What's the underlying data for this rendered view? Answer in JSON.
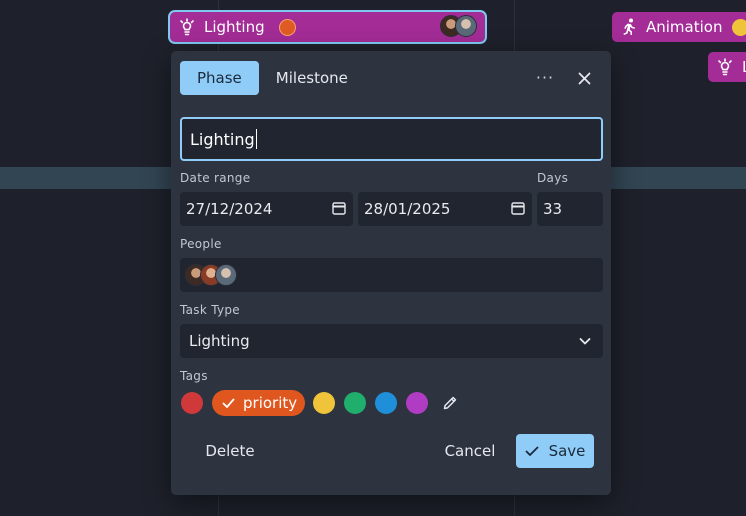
{
  "timeline": {
    "bars": [
      {
        "label": "Lighting",
        "icon": "lightbulb-icon",
        "color": "#a32c96",
        "tag_color": "#e05a24"
      },
      {
        "label": "Animation",
        "icon": "running-person-icon",
        "color": "#a32c96",
        "tag_color": "#f0c43a"
      },
      {
        "label": "L",
        "icon": "lightbulb-icon",
        "color": "#a32c96"
      }
    ]
  },
  "dialog": {
    "tabs": [
      {
        "label": "Phase",
        "active": true
      },
      {
        "label": "Milestone",
        "active": false
      }
    ],
    "more_label": "···",
    "name_value": "Lighting",
    "date_range_label": "Date range",
    "start_date": "27/12/2024",
    "end_date": "28/01/2025",
    "days_label": "Days",
    "days_value": "33",
    "people_label": "People",
    "people": [
      "avatar-1",
      "avatar-2",
      "avatar-3"
    ],
    "task_type_label": "Task Type",
    "task_type_value": "Lighting",
    "tags_label": "Tags",
    "tags": [
      {
        "color": "#d0393a",
        "label": ""
      },
      {
        "color": "#e0561f",
        "label": "priority",
        "selected": true
      },
      {
        "color": "#f0c43a",
        "label": ""
      },
      {
        "color": "#1fae6c",
        "label": ""
      },
      {
        "color": "#1e8fd8",
        "label": ""
      },
      {
        "color": "#b13cc4",
        "label": ""
      }
    ],
    "delete_label": "Delete",
    "cancel_label": "Cancel",
    "save_label": "Save",
    "accent_color": "#8fccf8"
  }
}
